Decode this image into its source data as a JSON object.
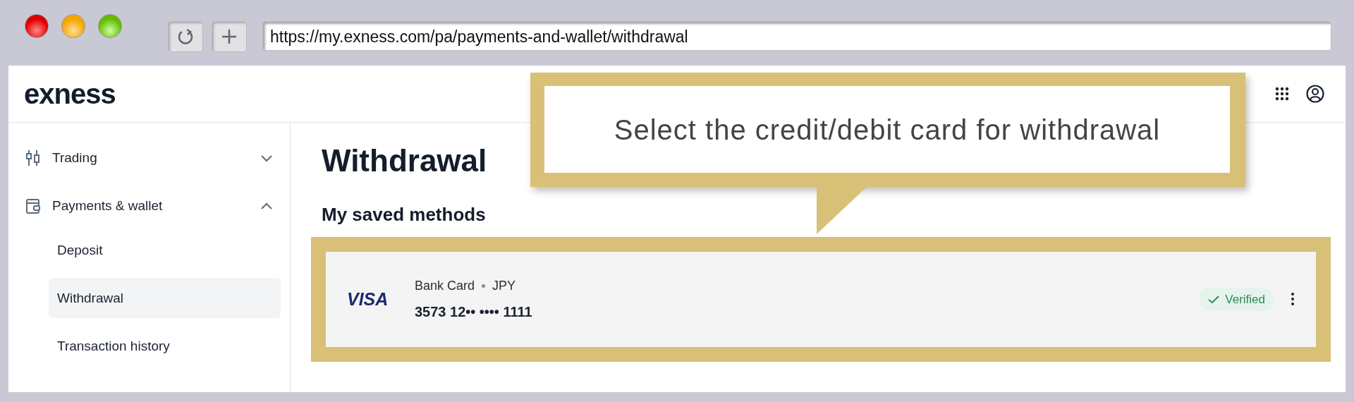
{
  "browser": {
    "url": "https://my.exness.com/pa/payments-and-wallet/withdrawal"
  },
  "header": {
    "logo": "exness"
  },
  "sidebar": {
    "items": [
      {
        "label": "Trading",
        "expanded": false
      },
      {
        "label": "Payments & wallet",
        "expanded": true,
        "children": [
          {
            "label": "Deposit",
            "selected": false
          },
          {
            "label": "Withdrawal",
            "selected": true
          },
          {
            "label": "Transaction history",
            "selected": false
          }
        ]
      }
    ]
  },
  "page": {
    "title": "Withdrawal",
    "section": "My saved methods",
    "methods": [
      {
        "brand": "VISA",
        "type": "Bank Card",
        "currency": "JPY",
        "number": "3573 12•• •••• 1111",
        "status": "Verified",
        "verified": true
      }
    ]
  },
  "callout": {
    "text": "Select the credit/debit card for withdrawal"
  }
}
